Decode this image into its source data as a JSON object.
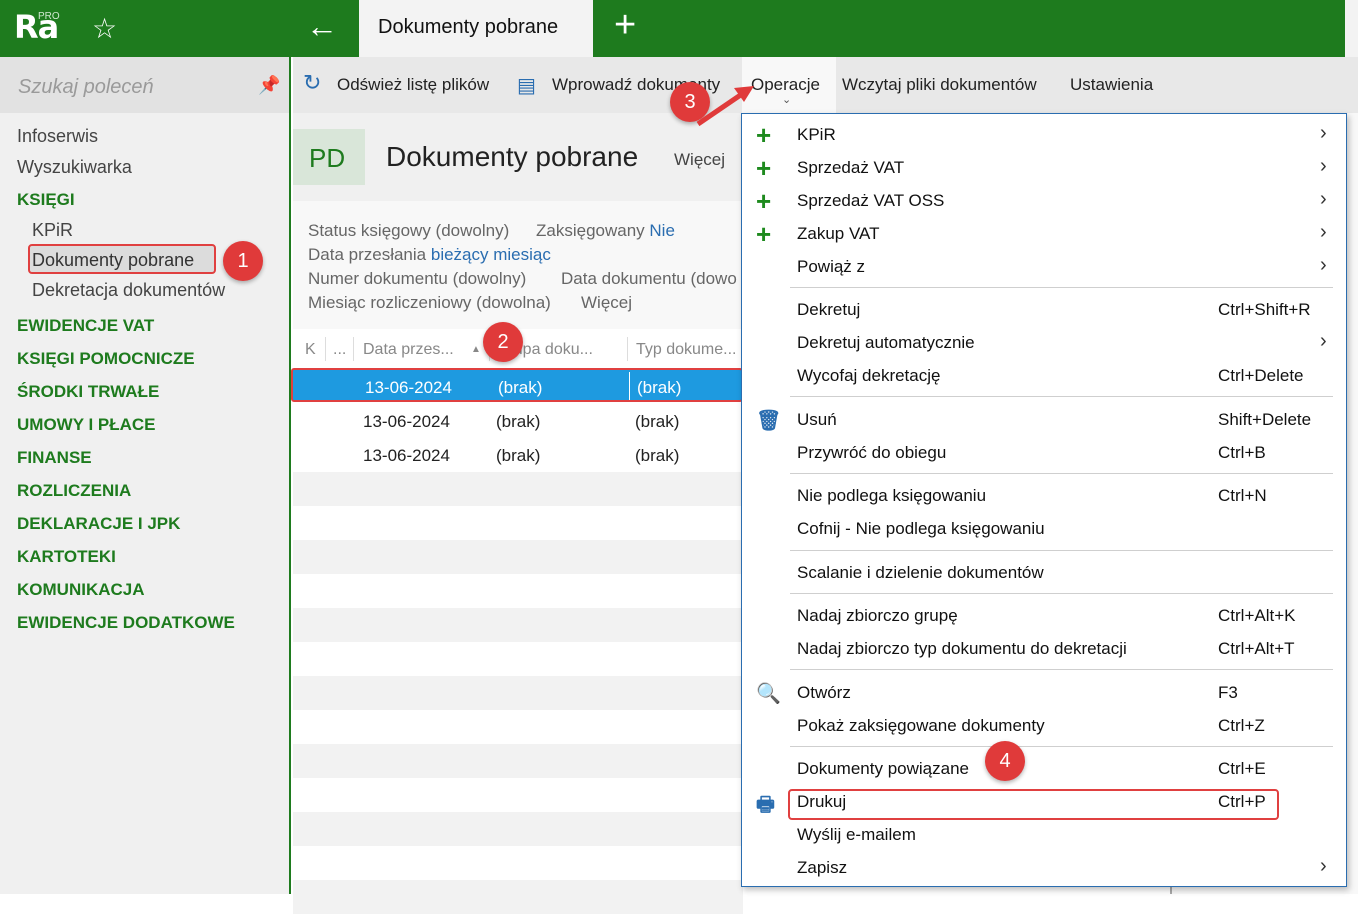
{
  "app": {
    "logo": "Ra",
    "logo_badge": "PRO",
    "active_tab": "Dokumenty pobrane"
  },
  "sidebar": {
    "search_placeholder": "Szukaj poleceń",
    "items": [
      {
        "label": "Infoserwis"
      },
      {
        "label": "Wyszukiwarka"
      }
    ],
    "sections": [
      {
        "label": "KSIĘGI"
      },
      {
        "label": "EWIDENCJE VAT"
      },
      {
        "label": "KSIĘGI POMOCNICZE"
      },
      {
        "label": "ŚRODKI TRWAŁE"
      },
      {
        "label": "UMOWY I PŁACE"
      },
      {
        "label": "FINANSE"
      },
      {
        "label": "ROZLICZENIA"
      },
      {
        "label": "DEKLARACJE I JPK"
      },
      {
        "label": "KARTOTEKI"
      },
      {
        "label": "KOMUNIKACJA"
      },
      {
        "label": "EWIDENCJE DODATKOWE"
      }
    ],
    "sub_items": [
      {
        "label": "KPiR"
      },
      {
        "label": "Dokumenty pobrane"
      },
      {
        "label": "Dekretacja dokumentów"
      }
    ]
  },
  "toolbar": {
    "refresh": "Odśwież listę plików",
    "import": "Wprowadź dokumenty",
    "operations": "Operacje",
    "load_files": "Wczytaj pliki dokumentów",
    "settings": "Ustawienia"
  },
  "header": {
    "badge": "PD",
    "title": "Dokumenty pobrane",
    "more": "Więcej"
  },
  "filters": {
    "status_label": "Status księgowy (dowolny)",
    "posted_label": "Zaksięgowany",
    "posted_value": "Nie",
    "sent_label": "Data przesłania",
    "sent_value": "bieżący miesiąc",
    "docnum_label": "Numer dokumentu (dowolny)",
    "docdate_label": "Data dokumentu (dowo",
    "month_label": "Miesiąc rozliczeniowy (dowolna)",
    "more": "Więcej"
  },
  "grid": {
    "headers": [
      "K",
      "...",
      "Data przes...",
      "Grupa doku...",
      "Typ dokume..."
    ],
    "rows": [
      {
        "date": "13-06-2024",
        "group": "(brak)",
        "type": "(brak)"
      },
      {
        "date": "13-06-2024",
        "group": "(brak)",
        "type": "(brak)"
      },
      {
        "date": "13-06-2024",
        "group": "(brak)",
        "type": "(brak)"
      }
    ]
  },
  "menu": {
    "items": [
      {
        "label": "KPiR",
        "shortcut": "",
        "icon": "plus-icon",
        "submenu": true
      },
      {
        "label": "Sprzedaż VAT",
        "shortcut": "",
        "icon": "plus-icon",
        "submenu": true
      },
      {
        "label": "Sprzedaż VAT OSS",
        "shortcut": "",
        "icon": "plus-icon",
        "submenu": true
      },
      {
        "label": "Zakup VAT",
        "shortcut": "",
        "icon": "plus-icon",
        "submenu": true
      },
      {
        "label": "Powiąż z",
        "shortcut": "",
        "icon": "",
        "submenu": true
      },
      {
        "label": "Dekretuj",
        "shortcut": "Ctrl+Shift+R",
        "icon": "",
        "submenu": false
      },
      {
        "label": "Dekretuj automatycznie",
        "shortcut": "",
        "icon": "",
        "submenu": true
      },
      {
        "label": "Wycofaj dekretację",
        "shortcut": "Ctrl+Delete",
        "icon": "",
        "submenu": false
      },
      {
        "label": "Usuń",
        "shortcut": "Shift+Delete",
        "icon": "trash-icon",
        "submenu": false
      },
      {
        "label": "Przywróć do obiegu",
        "shortcut": "Ctrl+B",
        "icon": "",
        "submenu": false
      },
      {
        "label": "Nie podlega księgowaniu",
        "shortcut": "Ctrl+N",
        "icon": "",
        "submenu": false
      },
      {
        "label": "Cofnij - Nie podlega księgowaniu",
        "shortcut": "",
        "icon": "",
        "submenu": false
      },
      {
        "label": "Scalanie i dzielenie dokumentów",
        "shortcut": "",
        "icon": "",
        "submenu": false
      },
      {
        "label": "Nadaj zbiorczo grupę",
        "shortcut": "Ctrl+Alt+K",
        "icon": "",
        "submenu": false
      },
      {
        "label": "Nadaj zbiorczo typ dokumentu do dekretacji",
        "shortcut": "Ctrl+Alt+T",
        "icon": "",
        "submenu": false
      },
      {
        "label": "Otwórz",
        "shortcut": "F3",
        "icon": "search-icon",
        "submenu": false
      },
      {
        "label": "Pokaż zaksięgowane dokumenty",
        "shortcut": "Ctrl+Z",
        "icon": "",
        "submenu": false
      },
      {
        "label": "Dokumenty powiązane",
        "shortcut": "Ctrl+E",
        "icon": "",
        "submenu": false
      },
      {
        "label": "Drukuj",
        "shortcut": "Ctrl+P",
        "icon": "printer-icon",
        "submenu": false
      },
      {
        "label": "Wyślij e-mailem",
        "shortcut": "",
        "icon": "",
        "submenu": false
      },
      {
        "label": "Zapisz",
        "shortcut": "",
        "icon": "",
        "submenu": true
      }
    ]
  },
  "callouts": [
    "1",
    "2",
    "3",
    "4"
  ],
  "colors": {
    "brand_green": "#1e7b1e",
    "selection_blue": "#1e9ae0",
    "callout_red": "#e03a3a",
    "link_blue": "#2a6db0"
  }
}
